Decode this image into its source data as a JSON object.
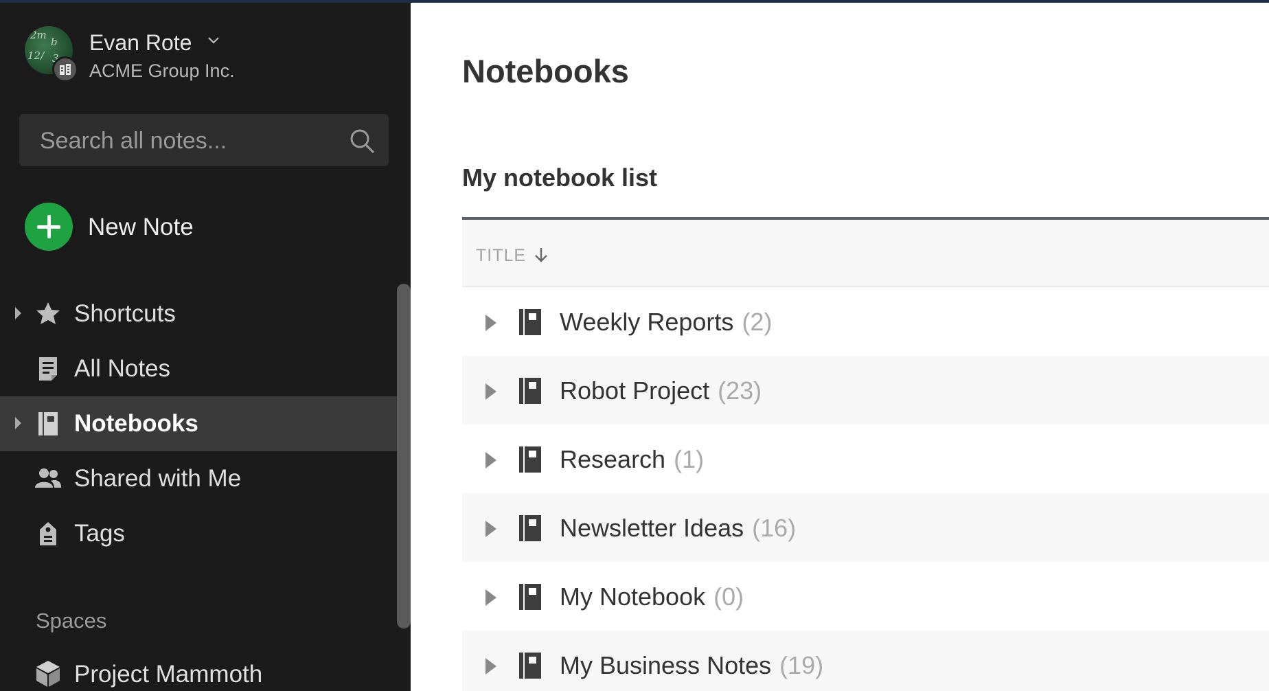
{
  "user": {
    "name": "Evan Rote",
    "org": "ACME Group Inc."
  },
  "search": {
    "placeholder": "Search all notes..."
  },
  "new_note": {
    "label": "New Note",
    "color": "#1fa342"
  },
  "sidebar": {
    "items": [
      {
        "label": "Shortcuts",
        "icon": "star-icon",
        "expandable": true,
        "active": false
      },
      {
        "label": "All Notes",
        "icon": "note-icon",
        "expandable": false,
        "active": false
      },
      {
        "label": "Notebooks",
        "icon": "notebook-icon",
        "expandable": true,
        "active": true
      },
      {
        "label": "Shared with Me",
        "icon": "people-icon",
        "expandable": false,
        "active": false
      },
      {
        "label": "Tags",
        "icon": "tag-icon",
        "expandable": false,
        "active": false
      }
    ],
    "spaces_label": "Spaces",
    "spaces": [
      {
        "label": "Project Mammoth",
        "icon": "cube-icon"
      }
    ]
  },
  "main": {
    "title": "Notebooks",
    "list_title": "My notebook list",
    "column_title": "TITLE",
    "notebooks": [
      {
        "name": "Weekly Reports",
        "count": "(2)"
      },
      {
        "name": "Robot Project",
        "count": "(23)"
      },
      {
        "name": "Research",
        "count": "(1)"
      },
      {
        "name": "Newsletter Ideas",
        "count": "(16)"
      },
      {
        "name": "My Notebook",
        "count": "(0)"
      },
      {
        "name": "My Business Notes",
        "count": "(19)"
      }
    ]
  }
}
